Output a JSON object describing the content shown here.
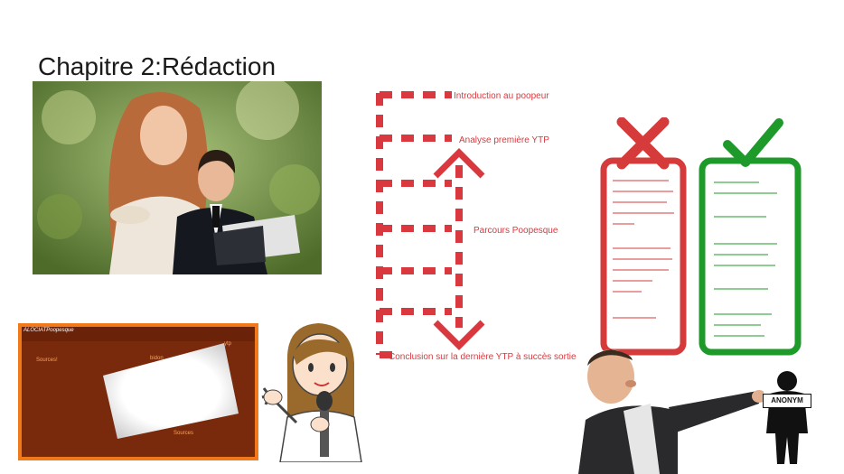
{
  "title": "Chapitre 2:Rédaction",
  "flowchart": {
    "steps": [
      "Introduction au poopeur",
      "Analyse première YTP",
      "Parcours Poopesque",
      "Conclusion sur la dernière YTP à succès sortie"
    ],
    "color": "#d9393e"
  },
  "website": {
    "logo": "ALOCIATPoopesque",
    "sources_label": "Sources!",
    "label_2": "bidon",
    "label_3": "ytp",
    "label_4": "Sources",
    "bg_color": "#7a2a0c",
    "border_color": "#f07a1a"
  },
  "checklists": {
    "bad_color": "#d53b3b",
    "good_color": "#1e9a2a"
  },
  "anonym_sign": "ANONYM"
}
